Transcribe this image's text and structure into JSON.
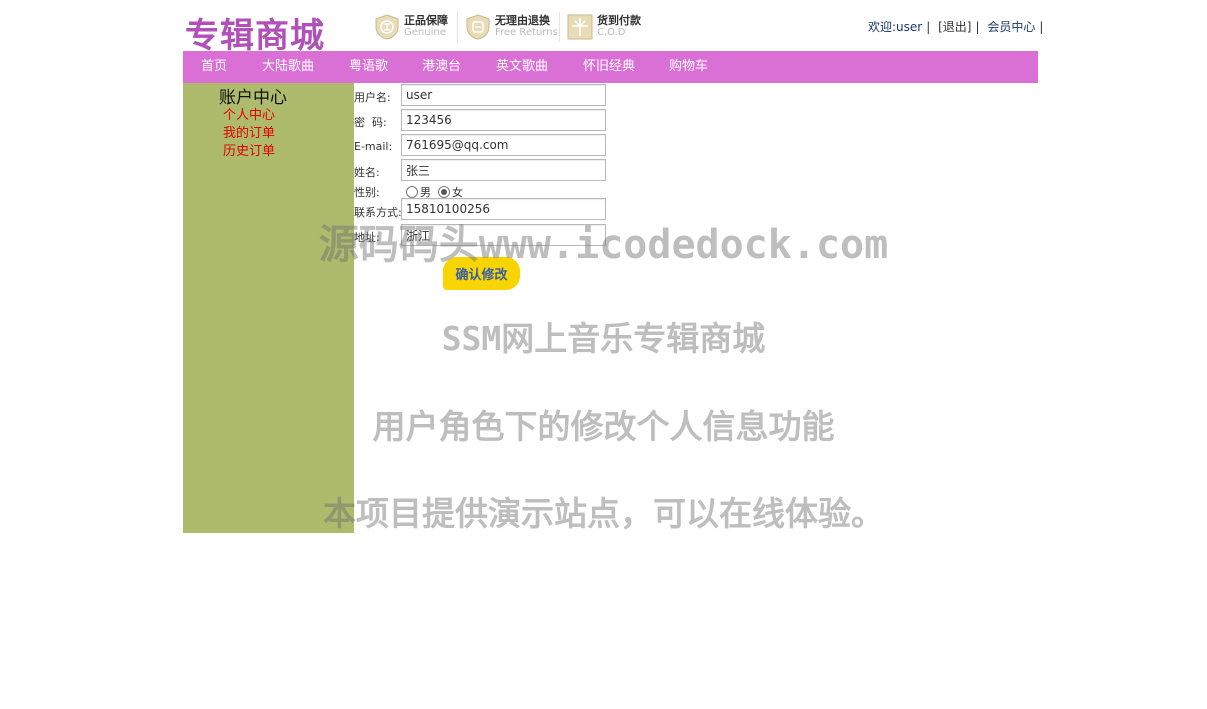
{
  "header": {
    "logo": "专辑商城",
    "badges": [
      {
        "icon": "shield-icon",
        "line1": "正品保障",
        "line2": "Genuine"
      },
      {
        "icon": "return-icon",
        "line1": "无理由退换",
        "line2": "Free Returns"
      },
      {
        "icon": "cash-on-delivery-icon",
        "line1": "货到付款",
        "line2": "C.O.D"
      }
    ],
    "welcome": "欢迎:user",
    "logout": "[退出]",
    "member_center": "会员中心"
  },
  "nav": {
    "items": [
      "首页",
      "大陆歌曲",
      "粤语歌",
      "港澳台",
      "英文歌曲",
      "怀旧经典",
      "购物车"
    ]
  },
  "sidebar": {
    "title": "账户中心",
    "links": [
      "个人中心",
      "我的订单",
      "历史订单"
    ]
  },
  "form": {
    "username_label": "用户名:",
    "username": "user",
    "password_label": "密  码:",
    "password": "123456",
    "email_label": "E-mail:",
    "email": "761695@qq.com",
    "name_label": "姓名:",
    "name": "张三",
    "gender_label": "性别:",
    "gender_male": "男",
    "gender_female": "女",
    "gender_selected": "女",
    "phone_label": "联系方式:",
    "phone": "15810100256",
    "address_label": "地址:",
    "address": "浙江",
    "submit_label": "确认修改"
  },
  "watermark": {
    "line1": "源码码头www.icodedock.com",
    "line2": "SSM网上音乐专辑商城",
    "line3": "用户角色下的修改个人信息功能",
    "line4": "本项目提供演示站点，可以在线体验。"
  },
  "colors": {
    "nav_bg": "#da70d6",
    "sidebar_bg": "#aebb6d",
    "submit_bg": "#f8d400",
    "sidebar_link": "#e30000",
    "logo": "#b050b8"
  }
}
